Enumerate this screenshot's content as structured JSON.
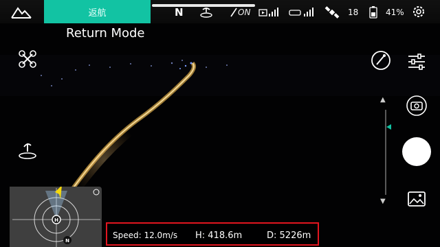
{
  "topbar": {
    "mode_label": "返航",
    "heading": "N",
    "vision_status": "ON",
    "gps_count": "18",
    "battery_percent": "41%"
  },
  "title": "Return Mode",
  "telemetry": {
    "speed": "Speed: 12.0m/s",
    "height": "H: 418.6m",
    "distance": "D: 5226m"
  },
  "minimap": {
    "north_label": "N"
  },
  "colors": {
    "accent": "#12c3a3",
    "highlight_border": "#e3151f",
    "aircraft_marker": "#f5d90a"
  },
  "icons": {
    "home": "home-icon",
    "landing": "landing-gear-icon",
    "vision": "obstacle-avoidance-icon",
    "video_signal": "video-signal-icon",
    "rc_signal": "remote-controller-signal-icon",
    "gps": "satellite-icon",
    "battery": "battery-icon",
    "settings": "gear-icon",
    "drone": "drone-icon",
    "return_home": "return-home-icon",
    "camera_settings": "camera-settings-icon",
    "params": "sliders-icon",
    "switch_camera": "switch-camera-icon",
    "gallery": "gallery-icon"
  }
}
